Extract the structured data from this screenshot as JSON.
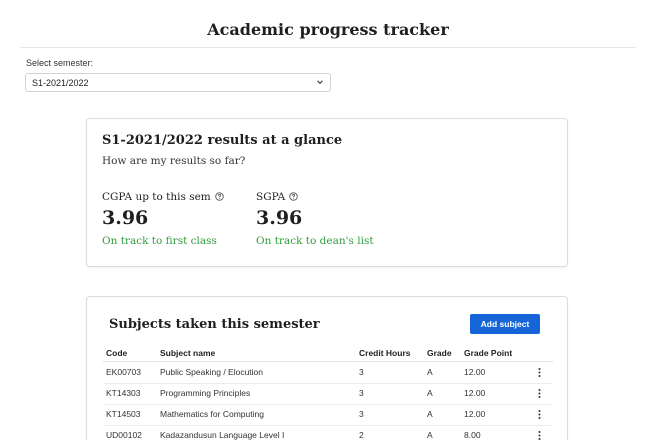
{
  "page": {
    "title": "Academic progress tracker"
  },
  "semester_select": {
    "label": "Select semester:",
    "value": "S1-2021/2022",
    "icon": "chevron-down-icon"
  },
  "glance": {
    "title": "S1-2021/2022 results at a glance",
    "subtitle": "How are my results so far?",
    "cgpa": {
      "label": "CGPA up to this sem",
      "value": "3.96",
      "status": "On track to first class"
    },
    "sgpa": {
      "label": "SGPA",
      "value": "3.96",
      "status": "On track to dean's list"
    },
    "status_color": "#2f9e3d"
  },
  "subjects": {
    "title": "Subjects taken this semester",
    "add_button": "Add subject",
    "accent": "#1565d8",
    "columns": [
      "Code",
      "Subject name",
      "Credit Hours",
      "Grade",
      "Grade Point"
    ],
    "rows": [
      {
        "code": "EK00703",
        "name": "Public Speaking / Elocution",
        "credit_hours": "3",
        "grade": "A",
        "grade_point": "12.00"
      },
      {
        "code": "KT14303",
        "name": "Programming Principles",
        "credit_hours": "3",
        "grade": "A",
        "grade_point": "12.00"
      },
      {
        "code": "KT14503",
        "name": "Mathematics for Computing",
        "credit_hours": "3",
        "grade": "A",
        "grade_point": "12.00"
      },
      {
        "code": "UD00102",
        "name": "Kadazandusun Language Level I",
        "credit_hours": "2",
        "grade": "A",
        "grade_point": "8.00"
      }
    ]
  }
}
